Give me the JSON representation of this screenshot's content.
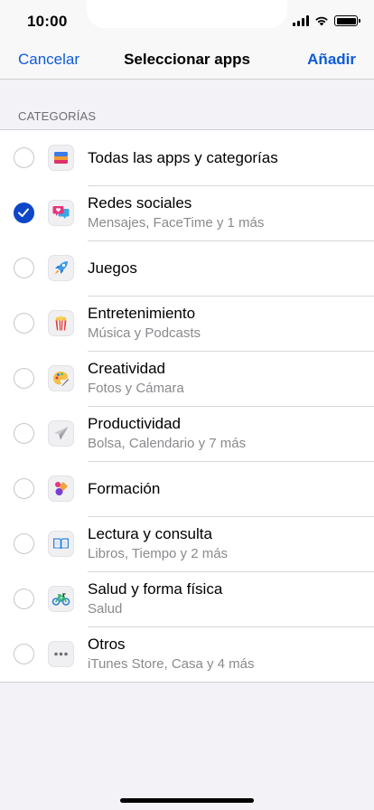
{
  "status_bar": {
    "time": "10:00"
  },
  "nav": {
    "cancel_label": "Cancelar",
    "title": "Seleccionar apps",
    "add_label": "Añadir"
  },
  "section": {
    "header": "CATEGORÍAS"
  },
  "categories": [
    {
      "title": "Todas las apps y categorías",
      "subtitle": "",
      "icon": "stack-icon",
      "selected": false
    },
    {
      "title": "Redes sociales",
      "subtitle": "Mensajes, FaceTime y 1 más",
      "icon": "chat-bubble-heart-icon",
      "selected": true
    },
    {
      "title": "Juegos",
      "subtitle": "",
      "icon": "rocket-icon",
      "selected": false
    },
    {
      "title": "Entretenimiento",
      "subtitle": "Música y Podcasts",
      "icon": "popcorn-icon",
      "selected": false
    },
    {
      "title": "Creatividad",
      "subtitle": "Fotos y Cámara",
      "icon": "palette-icon",
      "selected": false
    },
    {
      "title": "Productividad",
      "subtitle": "Bolsa, Calendario y 7 más",
      "icon": "paper-plane-icon",
      "selected": false
    },
    {
      "title": "Formación",
      "subtitle": "",
      "icon": "shapes-icon",
      "selected": false
    },
    {
      "title": "Lectura y consulta",
      "subtitle": "Libros, Tiempo y 2 más",
      "icon": "book-icon",
      "selected": false
    },
    {
      "title": "Salud y forma física",
      "subtitle": "Salud",
      "icon": "bicycle-icon",
      "selected": false
    },
    {
      "title": "Otros",
      "subtitle": "iTunes Store, Casa y 4 más",
      "icon": "ellipsis-icon",
      "selected": false
    }
  ],
  "colors": {
    "accent": "#0f5bd7",
    "check": "#0f46c8"
  }
}
